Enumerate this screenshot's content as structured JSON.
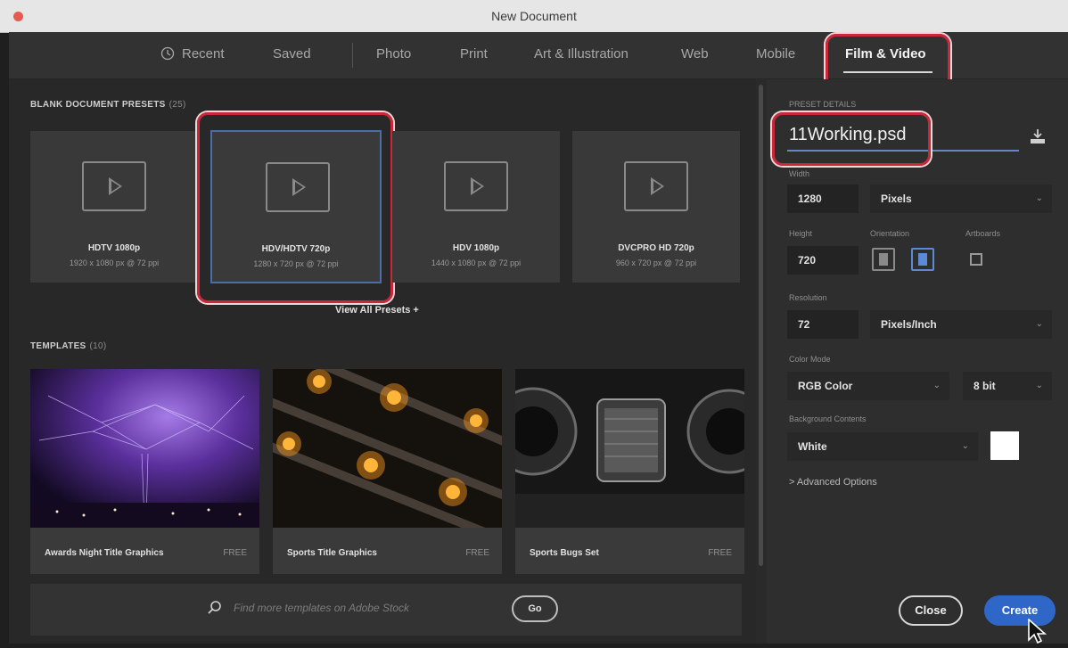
{
  "window": {
    "title": "New Document"
  },
  "tabs": [
    {
      "label": "Recent",
      "icon": "clock-icon"
    },
    {
      "label": "Saved"
    },
    {
      "label": "Photo"
    },
    {
      "label": "Print"
    },
    {
      "label": "Art & Illustration"
    },
    {
      "label": "Web"
    },
    {
      "label": "Mobile"
    },
    {
      "label": "Film & Video",
      "active": true
    }
  ],
  "presets_section": {
    "title": "BLANK DOCUMENT PRESETS",
    "count": "(25)"
  },
  "presets": [
    {
      "name": "HDTV 1080p",
      "desc": "1920 x 1080 px @ 72 ppi"
    },
    {
      "name": "HDV/HDTV 720p",
      "desc": "1280 x 720 px @ 72 ppi",
      "selected": true
    },
    {
      "name": "HDV 1080p",
      "desc": "1440 x 1080 px @ 72 ppi"
    },
    {
      "name": "DVCPRO HD 720p",
      "desc": "960 x 720 px @ 72 ppi"
    }
  ],
  "view_all": "View All Presets +",
  "templates_section": {
    "title": "TEMPLATES",
    "count": "(10)"
  },
  "templates": [
    {
      "name": "Awards Night Title Graphics",
      "price": "FREE"
    },
    {
      "name": "Sports Title Graphics",
      "price": "FREE"
    },
    {
      "name": "Sports Bugs Set",
      "price": "FREE"
    }
  ],
  "search": {
    "placeholder": "Find more templates on Adobe Stock",
    "go_label": "Go"
  },
  "details": {
    "section_label": "PRESET DETAILS",
    "name": "11Working.psd",
    "width_label": "Width",
    "width": "1280",
    "width_unit": "Pixels",
    "height_label": "Height",
    "height": "720",
    "orientation_label": "Orientation",
    "artboards_label": "Artboards",
    "resolution_label": "Resolution",
    "resolution": "72",
    "resolution_unit": "Pixels/Inch",
    "color_mode_label": "Color Mode",
    "color_mode": "RGB Color",
    "bit_depth": "8 bit",
    "background_label": "Background Contents",
    "background": "White",
    "background_color": "#ffffff",
    "advanced": "> Advanced Options"
  },
  "buttons": {
    "close": "Close",
    "create": "Create"
  },
  "colors": {
    "accent": "#2f67c9",
    "highlight": "#c9283a",
    "selection": "#4b6ea8"
  }
}
